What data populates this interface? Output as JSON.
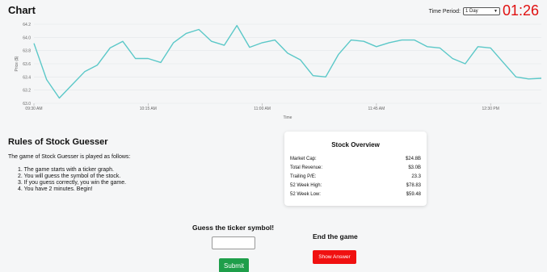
{
  "header": {
    "title": "Chart",
    "period_label": "Time Period:",
    "period_value": "1 Day",
    "timer": "01:26"
  },
  "chart_data": {
    "type": "line",
    "title": "",
    "xlabel": "Time",
    "ylabel": "Price ($)",
    "ylim": [
      63.0,
      64.2
    ],
    "y_ticks": [
      "63.0",
      "63.2",
      "63.4",
      "63.6",
      "63.8",
      "64.0",
      "64.2"
    ],
    "x_ticks": [
      {
        "label": "09:30 AM",
        "min": 0
      },
      {
        "label": "10:15 AM",
        "min": 45
      },
      {
        "label": "11:00 AM",
        "min": 90
      },
      {
        "label": "11:45 AM",
        "min": 135
      },
      {
        "label": "12:30 PM",
        "min": 180
      }
    ],
    "x_range_minutes": [
      0,
      200
    ],
    "line_color": "#5bc8c8",
    "grid": true,
    "series": [
      {
        "x": [
          0,
          5,
          10,
          15,
          20,
          25,
          30,
          35,
          40,
          45,
          50,
          55,
          60,
          65,
          70,
          75,
          80,
          85,
          90,
          95,
          100,
          105,
          110,
          115,
          120,
          125,
          130,
          135,
          140,
          145,
          150,
          155,
          160,
          165,
          170,
          175,
          180,
          185,
          190,
          195,
          200
        ],
        "values": [
          63.91,
          63.36,
          63.08,
          63.28,
          63.48,
          63.58,
          63.84,
          63.94,
          63.68,
          63.68,
          63.62,
          63.92,
          64.06,
          64.12,
          63.94,
          63.88,
          64.18,
          63.85,
          63.92,
          63.96,
          63.76,
          63.66,
          63.42,
          63.4,
          63.74,
          63.96,
          63.94,
          63.86,
          63.92,
          63.96,
          63.96,
          63.86,
          63.84,
          63.68,
          63.6,
          63.86,
          63.84,
          63.62,
          63.4,
          63.37,
          63.38
        ]
      }
    ]
  },
  "rules": {
    "title": "Rules of Stock Guesser",
    "intro": "The game of Stock Guesser is played as follows:",
    "items": [
      "1. The game starts with a ticker graph.",
      "2. You will guess the symbol of the stock.",
      "3. If you guess correctly, you win the game.",
      "4. You have 2 minutes. Begin!"
    ]
  },
  "overview": {
    "title": "Stock Overview",
    "rows": [
      {
        "label": "Market Cap:",
        "value": "$24.8B"
      },
      {
        "label": "Total Revenue:",
        "value": "$3.0B"
      },
      {
        "label": "Trailing P/E:",
        "value": "23.3"
      },
      {
        "label": "52 Week High:",
        "value": "$78.83"
      },
      {
        "label": "52 Week Low:",
        "value": "$59.48"
      }
    ]
  },
  "guess": {
    "title": "Guess the ticker symbol!",
    "input_value": "",
    "input_placeholder": "",
    "submit_label": "Submit"
  },
  "end": {
    "title": "End the game",
    "button_label": "Show Answer"
  }
}
